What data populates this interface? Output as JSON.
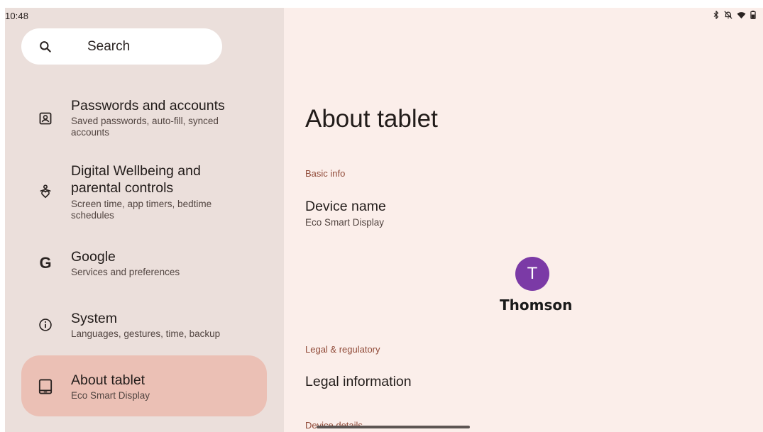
{
  "status_bar": {
    "time": "10:48",
    "icons": [
      "bluetooth-icon",
      "notifications-off-icon",
      "wifi-icon",
      "battery-icon"
    ]
  },
  "search": {
    "label": "Search",
    "icon": "search-icon"
  },
  "sidebar": {
    "items": [
      {
        "title": "Passwords and accounts",
        "subtitle": "Saved passwords, auto-fill, synced accounts",
        "icon": "account-box-icon",
        "selected": false
      },
      {
        "title": "Digital Wellbeing and parental controls",
        "subtitle": "Screen time, app timers, bedtime schedules",
        "icon": "wellbeing-icon",
        "selected": false
      },
      {
        "title": "Google",
        "subtitle": "Services and preferences",
        "icon": "google-icon",
        "selected": false
      },
      {
        "title": "System",
        "subtitle": "Languages, gestures, time, backup",
        "icon": "info-icon",
        "selected": false
      },
      {
        "title": "About tablet",
        "subtitle": "Eco Smart Display",
        "icon": "tablet-icon",
        "selected": true
      }
    ]
  },
  "detail": {
    "title": "About tablet",
    "sections": {
      "basic_info": "Basic info",
      "legal": "Legal & regulatory",
      "device_details": "Device details"
    },
    "device_name": {
      "title": "Device name",
      "value": "Eco Smart Display"
    },
    "avatar_letter": "T",
    "brand_name": "Thomson",
    "legal_information": "Legal information"
  },
  "colors": {
    "sidebar_bg": "#ebdfdb",
    "detail_bg": "#fbeeea",
    "selected_bg": "#ebc0b5",
    "section_label": "#904a38",
    "avatar_bg": "#7b3aa6"
  }
}
